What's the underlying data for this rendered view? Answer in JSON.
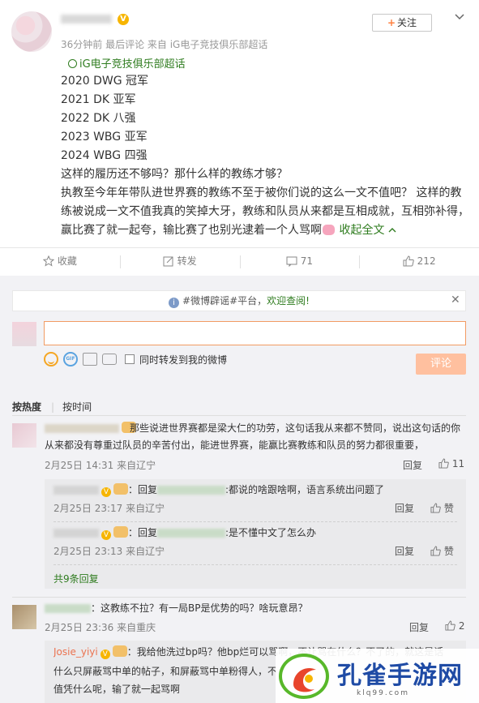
{
  "post": {
    "meta": "36分钟前 最后评论 来自 iG电子竞技俱乐部超话",
    "follow_label": "关注",
    "topic": "iG电子竞技俱乐部超话",
    "lines": [
      "2020 DWG 冠军",
      "2021 DK 亚军",
      "2022 DK 八强",
      "2023 WBG 亚军",
      "2024 WBG 四强",
      "这样的履历还不够吗？那什么样的教练才够？"
    ],
    "paragraph": "执教至今年年带队进世界赛的教练不至于被你们说的这么一文不值吧？ 这样的教练被说成一文不值我真的笑掉大牙，教练和队员从来都是互相成就，互相弥补得，赢比赛了就一起夸，输比赛了也别光逮着一个人骂啊",
    "expand_label": "收起全文"
  },
  "actions": {
    "favorite": "收藏",
    "repost": "转发",
    "comments": "71",
    "likes": "212"
  },
  "notice": {
    "text": "#微博辟谣#平台，",
    "welcome": "欢迎查阅!"
  },
  "composer": {
    "repost_checkbox_label": "同时转发到我的微博",
    "submit_label": "评论"
  },
  "sort": {
    "hot": "按热度",
    "time": "按时间"
  },
  "comments": [
    {
      "text": "那些说进世界赛都是梁大仁的功劳，这句话我从来都不赞同，说出这句话的你从来都没有尊重过队员的辛苦付出，能进世界赛，能赢比赛教练和队员的努力都很重要，",
      "date": "2月25日 14:31 来自辽宁",
      "reply_label": "回复",
      "likes": "11",
      "replies": [
        {
          "prefix": "：回复",
          "text": ":都说的啥跟啥啊，语言系统出问题了",
          "date": "2月25日 23:17 来自辽宁",
          "reply_label": "回复",
          "like_label": "赞"
        },
        {
          "prefix": "：回复",
          "text": ":是不懂中文了怎么办",
          "date": "2月25日 23:13 来自辽宁",
          "reply_label": "回复",
          "like_label": "赞"
        }
      ],
      "more_replies": "共9条回复"
    },
    {
      "text": "：这教练不拉？有一局BP是优势的吗？啥玩意昂？",
      "date": "2月25日 23:36 来自重庆",
      "reply_label": "回复",
      "likes": "2",
      "reply": {
        "name": "Josie_yiyi",
        "text": "：我给他洗过bp吗？他bp烂可以骂啊，不让骂在什么？不了的，就这是话",
        "line2": "什么只屏蔽骂中单的帖子，和屏蔽骂中单粉得人，不",
        "line3": "值凭什么呢，输了就一起骂啊"
      }
    }
  ],
  "watermark": {
    "name": "孔雀手游网",
    "url": "klq99.com"
  }
}
